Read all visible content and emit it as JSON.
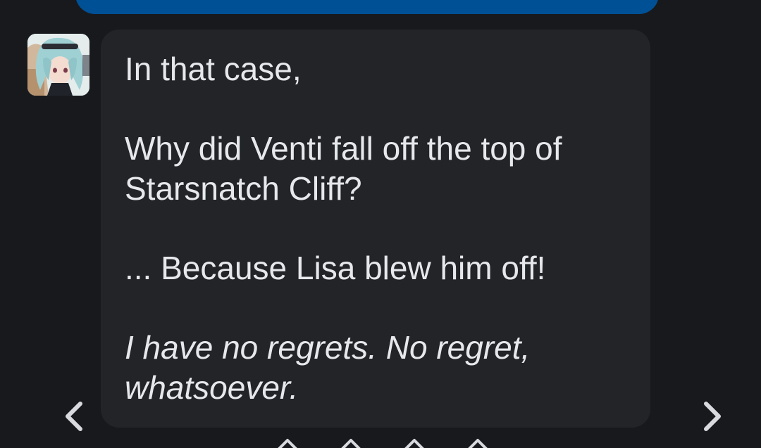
{
  "previous_message": {
    "color": "#005096"
  },
  "message": {
    "avatar_icon": "character-avatar-icon",
    "paragraphs": [
      {
        "lines": [
          "In that case,"
        ],
        "italic": false
      },
      {
        "lines": [
          "Why did Venti fall off the top of",
          "Starsnatch Cliff?"
        ],
        "italic": false
      },
      {
        "lines": [
          "... Because Lisa blew him off!"
        ],
        "italic": false
      },
      {
        "lines": [
          "I have no regrets. No regret,",
          "whatsoever."
        ],
        "italic": true
      }
    ]
  },
  "navigation": {
    "prev_icon": "chevron-left-icon",
    "next_icon": "chevron-right-icon"
  },
  "colors": {
    "background": "#18191c",
    "bubble": "#222428",
    "text": "#e6e8ec",
    "accent": "#005096"
  }
}
